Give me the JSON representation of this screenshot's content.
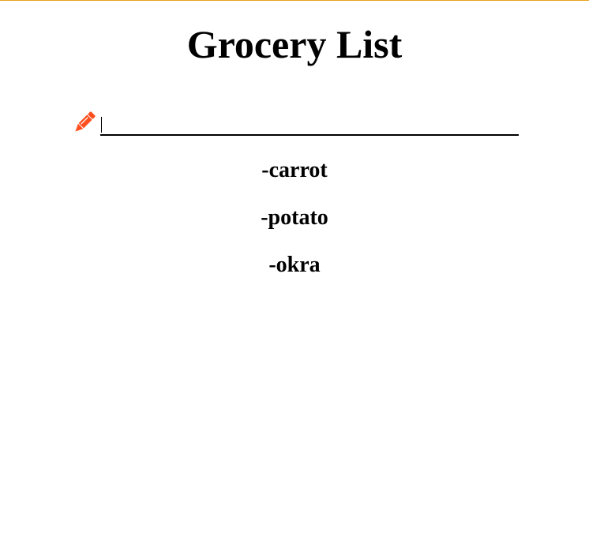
{
  "page": {
    "title": "Grocery List"
  },
  "input": {
    "value": "",
    "placeholder": "",
    "icon": "pencil-icon"
  },
  "items": [
    {
      "label": "-carrot"
    },
    {
      "label": "-potato"
    },
    {
      "label": "-okra"
    }
  ],
  "colors": {
    "accent": "#FF4F1F",
    "top_border": "#E8A01E"
  }
}
